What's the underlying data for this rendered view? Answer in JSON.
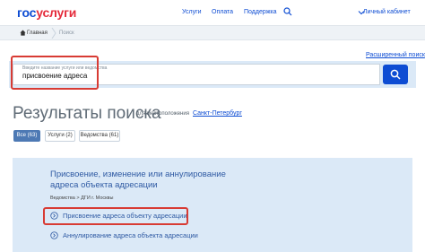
{
  "header": {
    "logo_part1": "гос",
    "logo_part2": "услуги",
    "nav": [
      "Услуги",
      "Оплата",
      "Поддержка"
    ],
    "cabinet_label": "Личный кабинет"
  },
  "breadcrumb": {
    "home": "Главная",
    "current": "Поиск"
  },
  "search": {
    "advanced_link": "Расширенный поиск",
    "hint": "Введите название услуги или ведомства",
    "value": "присвоение адреса"
  },
  "results": {
    "title": "Результаты поиска",
    "subtitle": "для местоположения",
    "city": "Санкт-Петербург",
    "tabs": [
      "Все (63)",
      "Услуги (2)",
      "Ведомства (61)"
    ]
  },
  "card": {
    "title": "Присвоение, изменение или аннулирование адреса объекта адресации",
    "path": "Ведомства > ДГИ г. Москвы",
    "items": [
      "Присвоение адреса объекту адресации",
      "Аннулирование адреса объекта адресации"
    ]
  },
  "colors": {
    "brand_blue": "#0d4cd3",
    "brand_red": "#e52b3b",
    "highlight_red": "#d83b34",
    "panel_blue": "#dbe9f7"
  }
}
